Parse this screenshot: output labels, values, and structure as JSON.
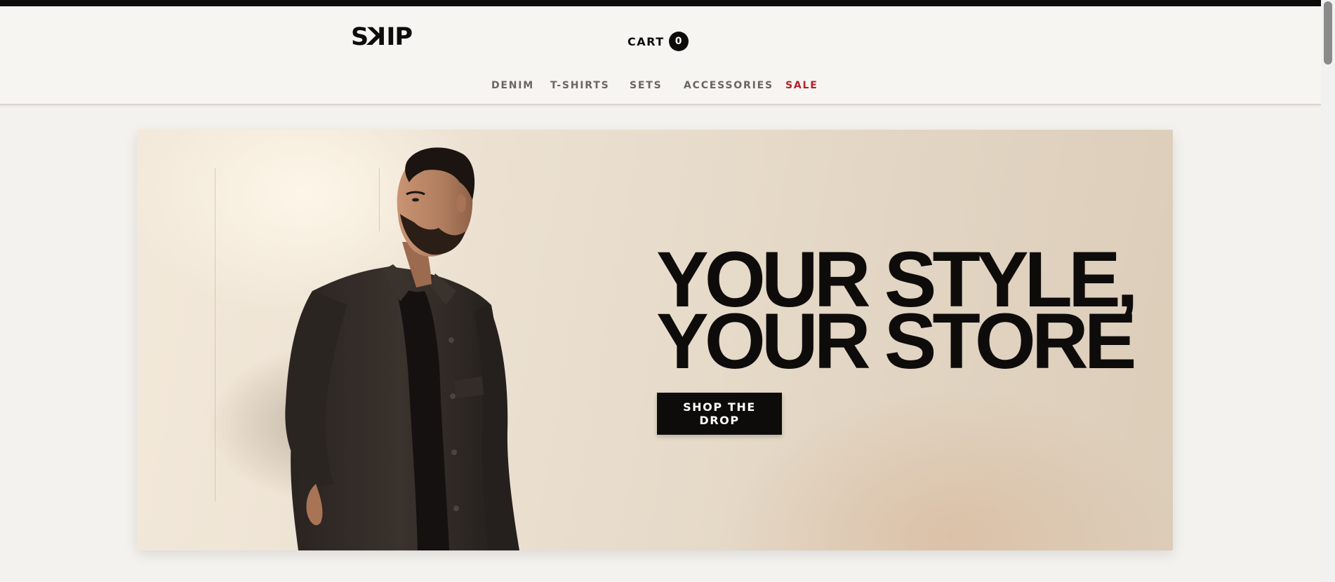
{
  "header": {
    "logo": "SKIP",
    "cart": {
      "label": "CART",
      "count": "0"
    }
  },
  "nav": {
    "items": [
      {
        "label": "DENIM"
      },
      {
        "label": "T-SHIRTS"
      },
      {
        "label": "SETS"
      },
      {
        "label": "ACCESSORIES"
      },
      {
        "label": "SALE",
        "color": "#b3202a"
      }
    ]
  },
  "hero": {
    "headline_line1": "YOUR STYLE,",
    "headline_line2": "YOUR STORE",
    "cta_label": "SHOP THE DROP",
    "image": "man-in-black-jacket-photo"
  },
  "colors": {
    "ink": "#0e0c0b",
    "background": "#f4f2ee",
    "header_bg": "#f7f5f1",
    "nav_text": "#6a6560",
    "sale": "#b3202a",
    "hero_bg": "#eadfcf"
  }
}
